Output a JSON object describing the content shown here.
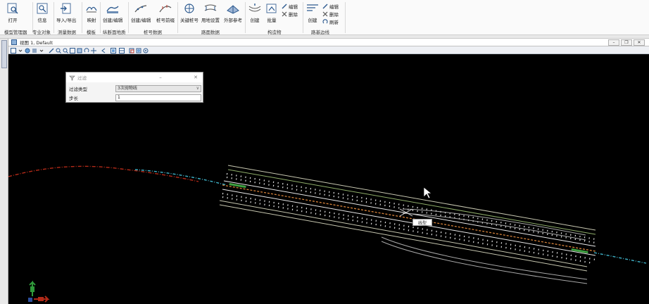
{
  "ribbon": {
    "open": "打开",
    "info": "信息",
    "import_export": "导入/导出",
    "map": "映射",
    "create_edit_1": "创建/编辑",
    "create_edit_2": "创建/编辑",
    "stake_front": "桩号前缀",
    "key_stake": "关键桩号",
    "land_setting": "用地设置",
    "external_ref": "外部参考",
    "create_3": "创建",
    "batch": "批量",
    "edit_1": "编辑",
    "delete_1": "删除",
    "create_4": "创建",
    "edit_2": "编辑",
    "delete_2": "删除",
    "refresh": "刷新",
    "groups": {
      "model_manager": "模型管理器",
      "specialty": "专业对象",
      "survey": "测量数据",
      "template": "模板",
      "profile": "纵断面地质",
      "stake": "桩号数据",
      "road_data": "路面数据",
      "structure": "构造物",
      "subgrade": "路基边线"
    }
  },
  "view": {
    "title": "视图 1, Default"
  },
  "dialog": {
    "title": "过滤",
    "type_label": "过滤类型",
    "type_value": "3次抛物线",
    "step_label": "步长",
    "step_value": "1"
  },
  "tooltip": "线型",
  "colors": {
    "canvas_bg": "#000000",
    "alignment_red": "#b32a18",
    "alignment_cyan": "#3fb3c9",
    "road_edge": "#c7c7b0",
    "center_orange": "#d5823a",
    "lane_white": "#e9e9e9",
    "green_marker": "#3ea040"
  }
}
